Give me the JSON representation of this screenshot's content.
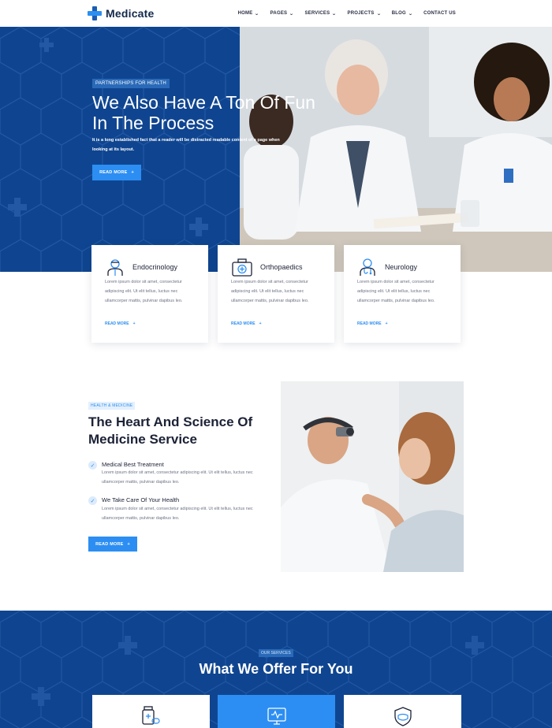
{
  "brand": {
    "name": "Medicate"
  },
  "nav": {
    "items": [
      {
        "label": "HOME",
        "has_dropdown": true
      },
      {
        "label": "PAGES",
        "has_dropdown": true
      },
      {
        "label": "SERVICES",
        "has_dropdown": true
      },
      {
        "label": "PROJECTS",
        "has_dropdown": true
      },
      {
        "label": "BLOG",
        "has_dropdown": true
      },
      {
        "label": "CONTACT US",
        "has_dropdown": false
      }
    ]
  },
  "hero": {
    "badge": "PARTNERSHIPS FOR HEALTH",
    "title": "We Also Have A Ton Of Fun In The Process",
    "text": "It is a long established fact that a reader will be distracted readable content of a page when looking at its layout.",
    "button": "READ MORE"
  },
  "features": [
    {
      "icon": "doctor-icon",
      "title": "Endocrinology",
      "text": "Lorem ipsum dolor sit amet, consectetur adipiscing elit. Ut elit tellus, luctus nec ullamcorper mattis, pulvinar dapibus leo.",
      "link": "READ MORE"
    },
    {
      "icon": "medical-kit-icon",
      "title": "Orthopaedics",
      "text": "Lorem ipsum dolor sit amet, consectetur adipiscing elit. Ut elit tellus, luctus nec ullamcorper mattis, pulvinar dapibus leo.",
      "link": "READ MORE"
    },
    {
      "icon": "doctor-stethoscope-icon",
      "title": "Neurology",
      "text": "Lorem ipsum dolor sit amet, consectetur adipiscing elit. Ut elit tellus, luctus nec ullamcorper mattis, pulvinar dapibus leo.",
      "link": "READ MORE"
    }
  ],
  "about": {
    "tag": "HEALTH & MEDICINE",
    "title": "The Heart And Science Of Medicine Service",
    "items": [
      {
        "title": "Medical Best Treatment",
        "text": "Lorem ipsum dolor sit amet, consectetur adipiscing elit. Ut elit tellus, luctus nec ullamcorper mattis, pulvinar dapibus leo."
      },
      {
        "title": "We Take Care Of Your Health",
        "text": "Lorem ipsum dolor sit amet, consectetur adipiscing elit. Ut elit tellus, luctus nec ullamcorper mattis, pulvinar dapibus leo."
      }
    ],
    "button": "READ MORE"
  },
  "services": {
    "tag": "OUR SERVICES",
    "title": "What We Offer For You",
    "cards": [
      {
        "icon": "medicine-bottle-icon",
        "active": false
      },
      {
        "icon": "medical-monitor-icon",
        "active": true
      },
      {
        "icon": "face-mask-shield-icon",
        "active": false
      }
    ]
  },
  "colors": {
    "primary_blue": "#0f4590",
    "accent_blue": "#2c8ef2",
    "heading": "#1c2236",
    "body_text": "#6d7384"
  }
}
